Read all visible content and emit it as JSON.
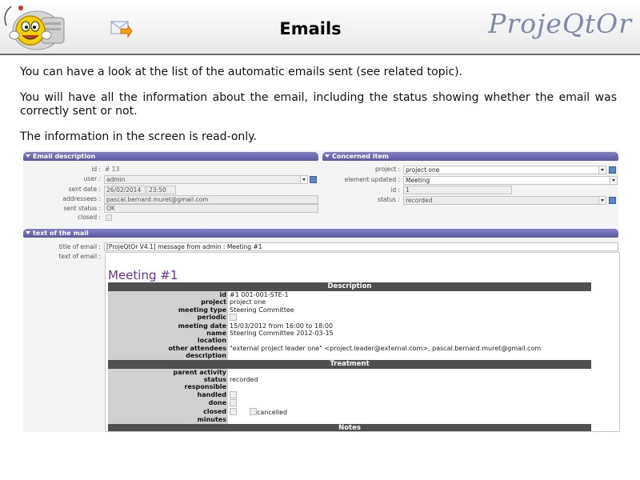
{
  "header": {
    "title": "Emails",
    "brand": "ProjeQtOr"
  },
  "intro": {
    "p1": "You can have a look at the list of the automatic emails sent (see related topic).",
    "p2": "You will have all the information about the email, including the status showing whether the email was correctly sent or not.",
    "p3": "The information in the screen is read-only."
  },
  "email_description": {
    "section": "Email description",
    "id_label": "id :",
    "id_value": "# 13",
    "user_label": "user :",
    "user_value": "admin",
    "sent_date_label": "sent date :",
    "sent_date_value": "26/02/2014",
    "sent_time_value": "23:50",
    "addressees_label": "addressees :",
    "addressees_value": "pascal.bernard.muret@gmail.com",
    "sent_status_label": "sent status :",
    "sent_status_value": "OK",
    "closed_label": "closed :"
  },
  "concerned_item": {
    "section": "Concerned item",
    "project_label": "project :",
    "project_value": "project one",
    "element_label": "element updated :",
    "element_value": "Meeting",
    "id_label": "id :",
    "id_value": "1",
    "status_label": "status :",
    "status_value": "recorded"
  },
  "text_of_mail": {
    "section": "text of the mail",
    "title_label": "title of email :",
    "title_value": "[ProjeQtOr V4.1] message from admin : Meeting #1",
    "text_label": "text of email :",
    "mail_title": "Meeting #1",
    "h_description": "Description",
    "id_k": "id",
    "id_v": "#1   001-001-STE-1",
    "project_k": "project",
    "project_v": "project one",
    "meeting_type_k": "meeting type",
    "meeting_type_v": "Steering Committee",
    "periodic_k": "periodic",
    "meeting_date_k": "meeting date",
    "meeting_date_v": "15/03/2012 from    16:00 to     18:00",
    "name_k": "name",
    "name_v": "Steering Committee 2012-03-15",
    "location_k": "location",
    "attendees_k": "other attendees",
    "attendees_v": "\"external project leader one\" <project.leader@external.com>, pascal.bernard.muret@gmail.com",
    "description_k": "description",
    "h_treatment": "Treatment",
    "parent_k": "parent activity",
    "status_k": "status",
    "status_v": "recorded",
    "responsible_k": "responsible",
    "handled_k": "handled",
    "done_k": "done",
    "closed_k": "closed",
    "cancelled_v": "cancelled",
    "minutes_k": "minutes",
    "h_notes": "Notes"
  },
  "colors": {
    "section_header": "#6663ad",
    "mail_title": "#6b2f97",
    "brand": "#7f8aa6"
  }
}
